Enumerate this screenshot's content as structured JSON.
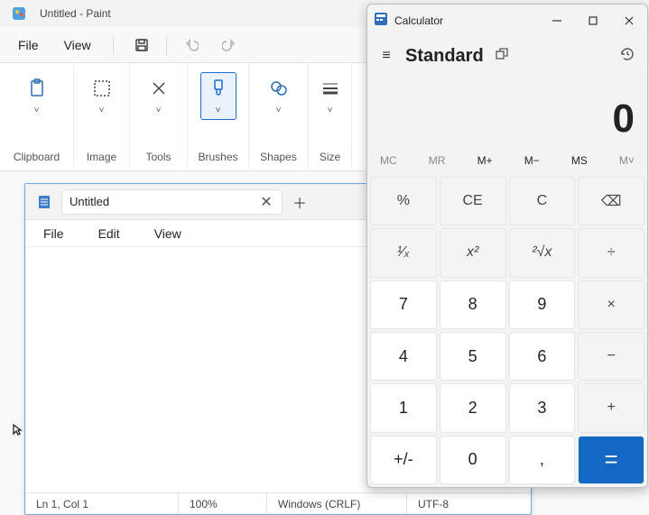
{
  "paint": {
    "title": "Untitled - Paint",
    "menu": {
      "file": "File",
      "view": "View"
    },
    "ribbon": {
      "clipboard": "Clipboard",
      "image": "Image",
      "tools": "Tools",
      "brushes": "Brushes",
      "shapes": "Shapes",
      "size": "Size"
    }
  },
  "notepad": {
    "tab_title": "Untitled",
    "menu": {
      "file": "File",
      "edit": "Edit",
      "view": "View"
    },
    "status": {
      "pos": "Ln 1, Col 1",
      "zoom": "100%",
      "eol": "Windows (CRLF)",
      "encoding": "UTF-8"
    }
  },
  "calc": {
    "title": "Calculator",
    "mode": "Standard",
    "display": "0",
    "memory": {
      "mc": "MC",
      "mr": "MR",
      "mplus": "M+",
      "mminus": "M−",
      "ms": "MS",
      "mlist": "M˅"
    },
    "keys": {
      "pct": "%",
      "ce": "CE",
      "c": "C",
      "back": "⌫",
      "inv": "¹⁄ₓ",
      "sq": "x²",
      "sqrt": "²√x",
      "div": "÷",
      "k7": "7",
      "k8": "8",
      "k9": "9",
      "mul": "×",
      "k4": "4",
      "k5": "5",
      "k6": "6",
      "sub": "−",
      "k1": "1",
      "k2": "2",
      "k3": "3",
      "add": "+",
      "neg": "+/-",
      "k0": "0",
      "dec": ",",
      "eq": "="
    }
  }
}
